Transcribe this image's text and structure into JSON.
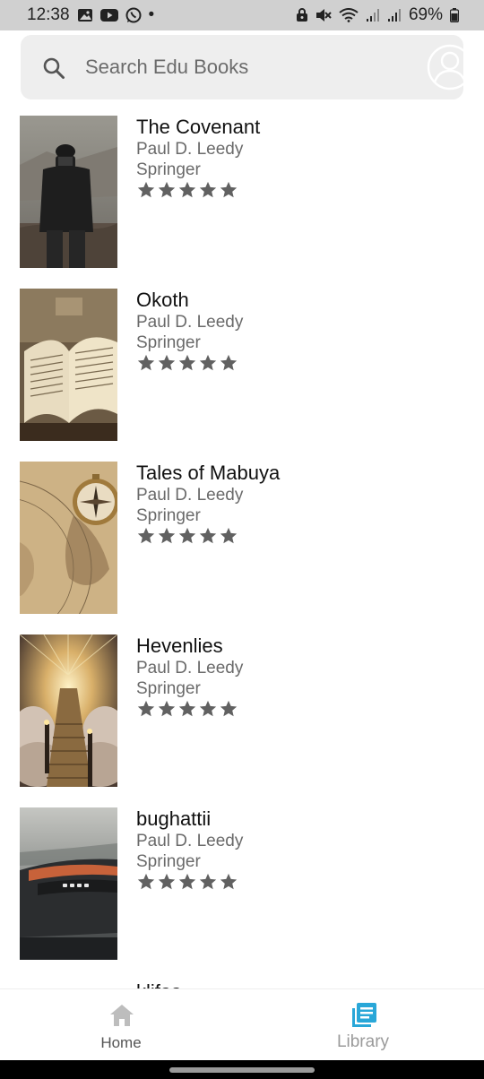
{
  "status_bar": {
    "time": "12:38",
    "dot": "•",
    "battery": "69%",
    "left_icons": [
      "gallery-icon",
      "youtube-icon",
      "whatsapp-icon"
    ],
    "right_icons": [
      "lock-icon",
      "mute-icon",
      "wifi-icon",
      "signal-icon",
      "signal-icon",
      "battery-icon"
    ]
  },
  "search": {
    "placeholder": "Search Edu Books",
    "value": ""
  },
  "books": [
    {
      "title": "The Covenant",
      "author": "Paul D. Leedy",
      "publisher": "Springer",
      "stars": 5,
      "cover": "photographer"
    },
    {
      "title": "Okoth",
      "author": "Paul D. Leedy",
      "publisher": "Springer",
      "stars": 5,
      "cover": "open-book"
    },
    {
      "title": "Tales of Mabuya",
      "author": "Paul D. Leedy",
      "publisher": "Springer",
      "stars": 5,
      "cover": "compass-map"
    },
    {
      "title": "Hevenlies",
      "author": "Paul D. Leedy",
      "publisher": "Springer",
      "stars": 5,
      "cover": "stairway-heaven"
    },
    {
      "title": "bughattii",
      "author": "Paul D. Leedy",
      "publisher": "Springer",
      "stars": 5,
      "cover": "sports-car"
    },
    {
      "title": "klifas",
      "author": "",
      "publisher": "",
      "stars": 0,
      "cover": ""
    }
  ],
  "nav": {
    "home_label": "Home",
    "library_label": "Library"
  },
  "colors": {
    "star": "#616161",
    "library_active": "#29a7d8",
    "home_icon": "#bdbdbd",
    "search_bg": "#eeeeee"
  }
}
